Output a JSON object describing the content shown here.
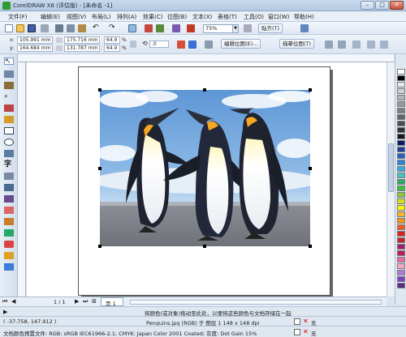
{
  "window": {
    "title": "CorelDRAW X6 (评估版) - [未命名 -1]",
    "minimize": "–",
    "maximize": "□",
    "close": "✕"
  },
  "menu": {
    "items": [
      "文件(F)",
      "编辑(E)",
      "视图(V)",
      "布局(L)",
      "排列(A)",
      "效果(C)",
      "位图(B)",
      "文本(X)",
      "表格(T)",
      "工具(O)",
      "窗口(W)",
      "帮助(H)"
    ]
  },
  "toolbar": {
    "zoom": "75%",
    "snap": "贴齐(T)"
  },
  "properties": {
    "x_label": "x:",
    "x_value": "105.991 mm",
    "y_label": "y:",
    "y_value": "164.684 mm",
    "w_value": "175.716 mm",
    "h_value": "131.787 mm",
    "scale_x": "64.9",
    "scale_y": "64.9",
    "pct": "%",
    "rotation": ".0",
    "edit_bitmap": "编辑位图(E)...",
    "trace_bitmap": "描摹位图(T)"
  },
  "pager": {
    "pos": "1 / 1",
    "tab": "页 1"
  },
  "status": {
    "hint": "将颜色(或对象)拖动至此处，以便将这些颜色与文档存储在一起",
    "coords": "( -37.758, 147.912 )",
    "object": "Penguins.jpg (RGB) 于 图层 1 148 x 148 dpi",
    "profile": "文档颜色预置文件: RGB: sRGB IEC61966-2.1; CMYK: Japan Color 2001 Coated; 灰度: Dot Gain 15%",
    "fill_none": "无",
    "outline_none": "无"
  },
  "colors": {
    "palette": [
      "#ffffff",
      "#000000",
      "#e8e8e8",
      "#cfcfcf",
      "#b3b3b3",
      "#999999",
      "#7f7f7f",
      "#666666",
      "#4d4d4d",
      "#333333",
      "#1a1a1a",
      "#0d1a66",
      "#1f3f99",
      "#2a5fbf",
      "#2e86d6",
      "#3aa8e0",
      "#49c0c0",
      "#2fa86a",
      "#3dbd3d",
      "#8dc63f",
      "#d7df23",
      "#fff200",
      "#f7b32b",
      "#f7941d",
      "#f15a24",
      "#e02020",
      "#c1272d",
      "#9e1f63",
      "#c2185b",
      "#e86aa6",
      "#f4a6c6",
      "#b07cd8",
      "#7f3fbf",
      "#5b2a86"
    ]
  }
}
